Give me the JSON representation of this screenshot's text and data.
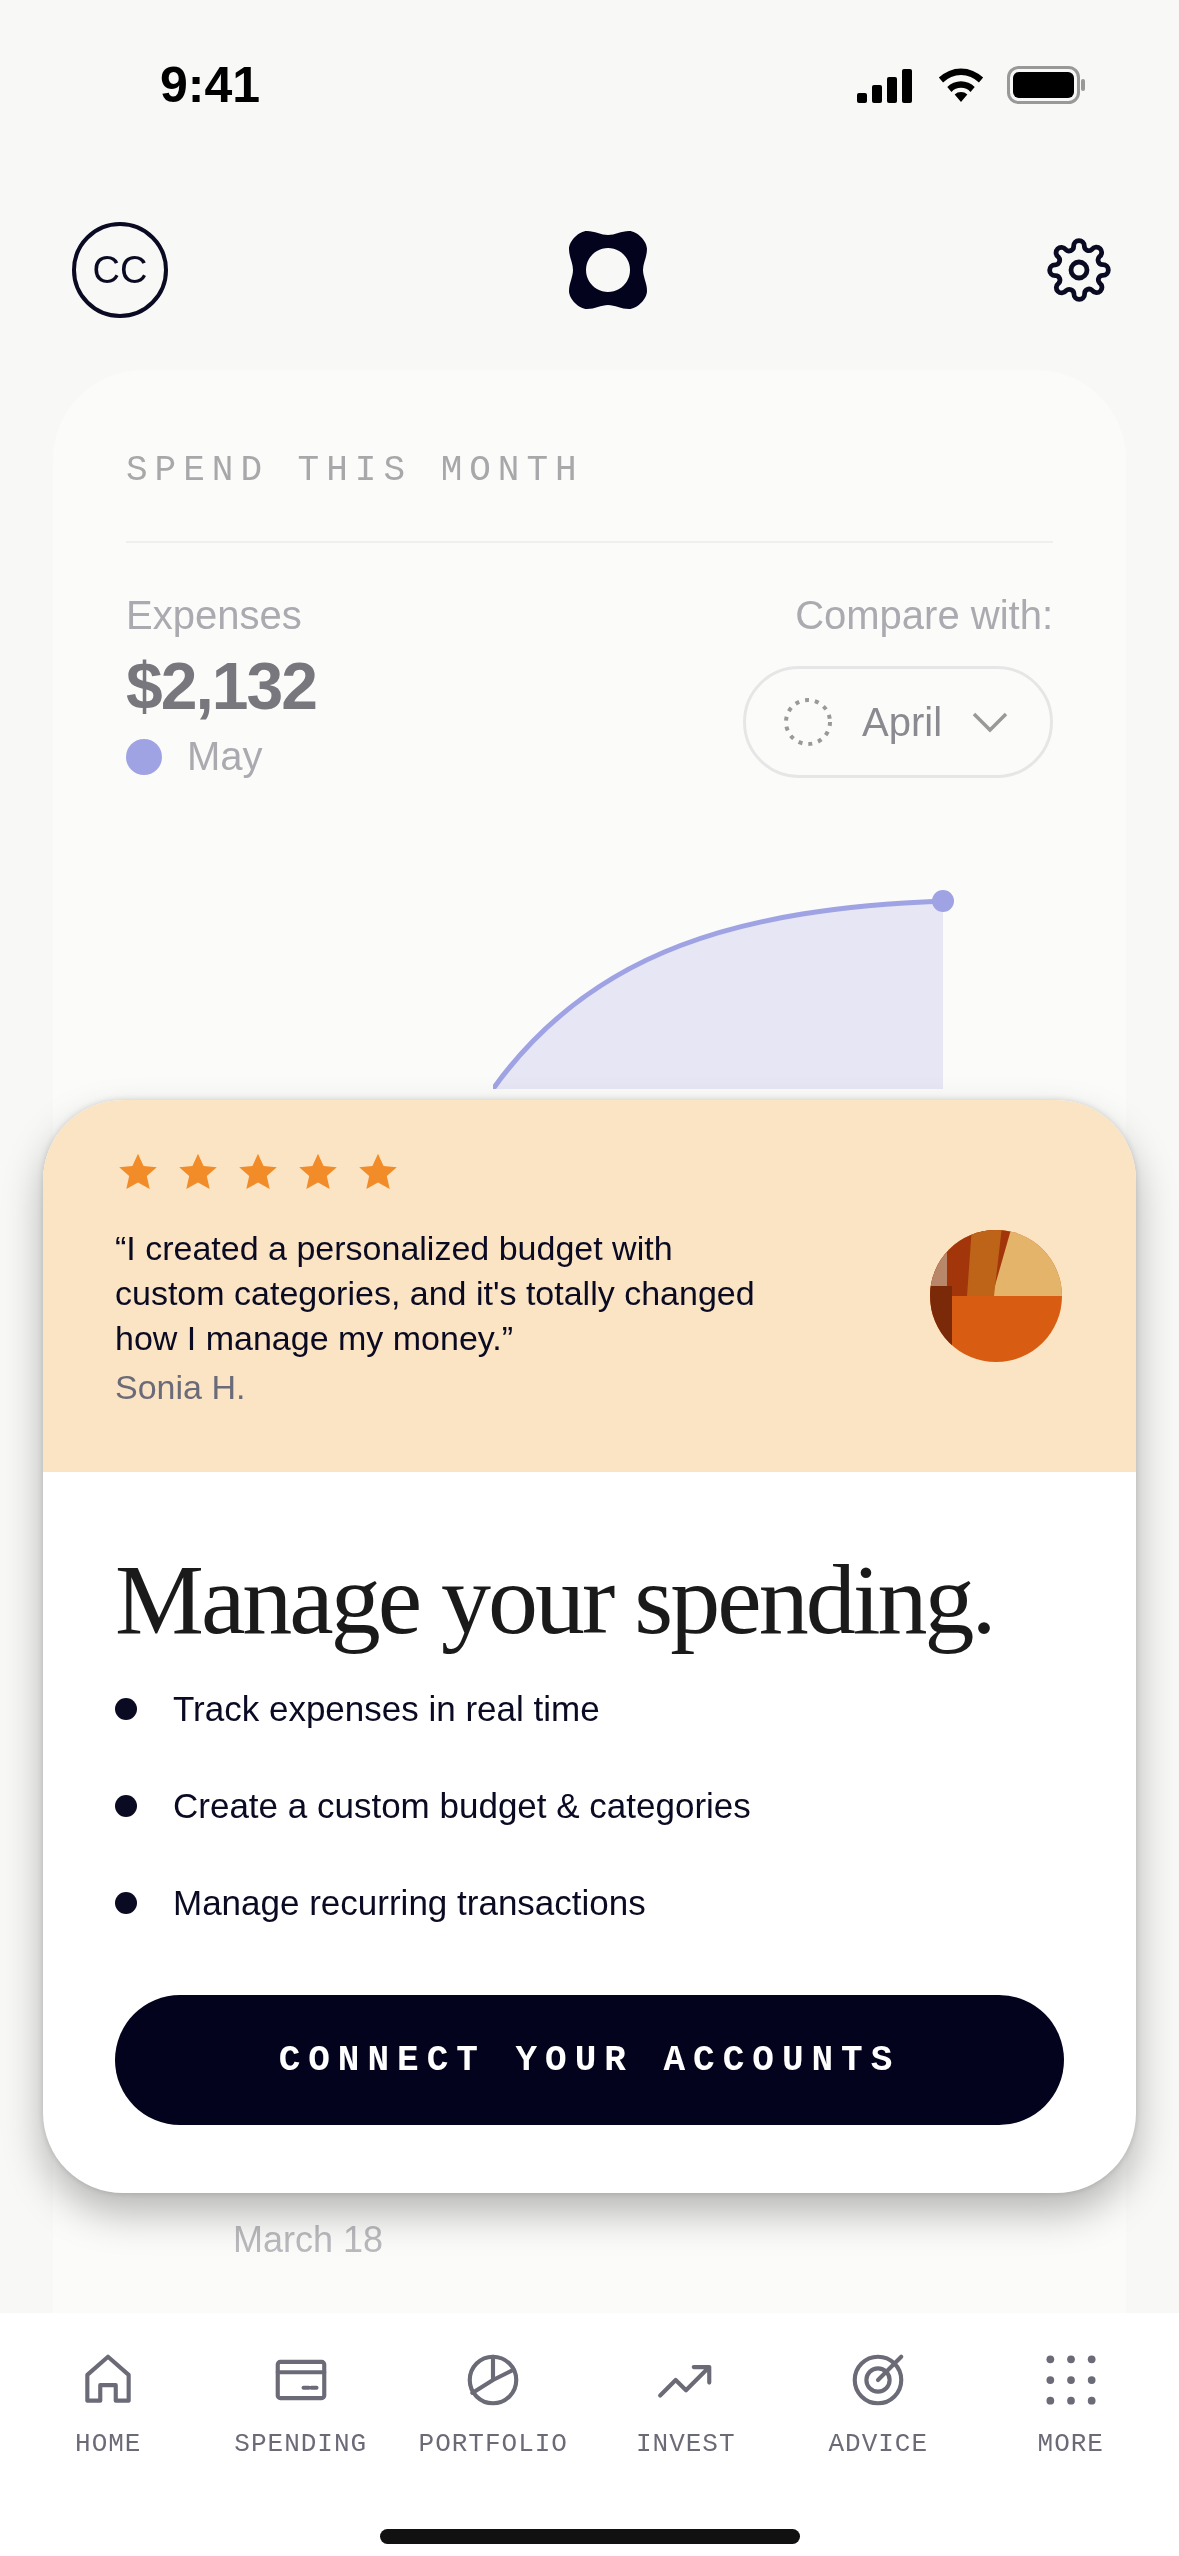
{
  "status_bar": {
    "time": "9:41"
  },
  "header": {
    "avatar_initials": "CC"
  },
  "spend_card": {
    "title": "SPEND THIS MONTH",
    "expenses_label": "Expenses",
    "amount": "$2,132",
    "legend": {
      "label": "May",
      "color": "#9fa3e3"
    },
    "compare_label": "Compare with:",
    "compare_value": "April",
    "transaction_date": "March 18"
  },
  "promo": {
    "stars": 5,
    "quote": "“I created a personalized budget with custom categories, and it's totally changed how I manage my money.”",
    "author": "Sonia H.",
    "title": "Manage your spending.",
    "bullets": [
      "Track expenses in real time",
      "Create a custom budget & categories",
      "Manage recurring transactions"
    ],
    "button": "CONNECT YOUR ACCOUNTS"
  },
  "tab_bar": [
    {
      "label": "HOME"
    },
    {
      "label": "SPENDING"
    },
    {
      "label": "PORTFOLIO"
    },
    {
      "label": "INVEST"
    },
    {
      "label": "ADVICE"
    },
    {
      "label": "MORE"
    }
  ]
}
